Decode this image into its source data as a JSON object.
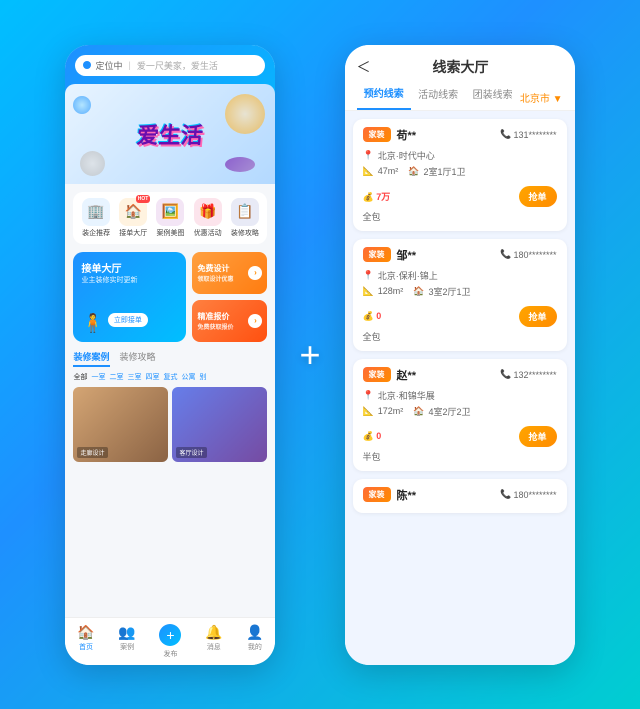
{
  "page": {
    "bg_gradient_start": "#00bfff",
    "bg_gradient_end": "#1e90ff"
  },
  "phone_left": {
    "status_text": "定位中",
    "search_placeholder": "爱一尺美家，爱生活",
    "banner_text": "爱生活",
    "icon_grid": [
      {
        "icon": "🏢",
        "label": "装企推荐",
        "color": "#e8f4ff",
        "hot": false
      },
      {
        "icon": "🏠",
        "label": "接单大厅",
        "color": "#fff3e0",
        "hot": true
      },
      {
        "icon": "🖼️",
        "label": "案例美图",
        "color": "#f3e5f5",
        "hot": false
      },
      {
        "icon": "🎁",
        "label": "优惠活动",
        "color": "#fce4ec",
        "hot": false
      },
      {
        "icon": "📋",
        "label": "装修攻略",
        "color": "#e8eaf6",
        "hot": false
      }
    ],
    "promo_left": {
      "title": "接单大厅",
      "sub": "业主装修实时更新",
      "btn_label": "立即接单"
    },
    "promo_right": [
      {
        "label": "免费设计",
        "color": "#ff8c00"
      },
      {
        "label": "精准报价",
        "color": "#ff6b35"
      }
    ],
    "case_tabs": [
      "装修案例",
      "装修攻略"
    ],
    "filter_tags": [
      "全部",
      "一室",
      "二室",
      "三室",
      "四室",
      "复式",
      "公寓",
      "别"
    ],
    "nav_items": [
      {
        "icon": "🏠",
        "label": "首页",
        "active": true
      },
      {
        "icon": "👥",
        "label": "案例",
        "active": false
      },
      {
        "icon": "+",
        "label": "发布",
        "is_plus": true
      },
      {
        "icon": "🔔",
        "label": "消息",
        "active": false
      },
      {
        "icon": "👤",
        "label": "我的",
        "active": false
      }
    ]
  },
  "plus_sign": "+",
  "phone_right": {
    "back_label": "＜",
    "title": "线索大厅",
    "tabs": [
      {
        "label": "预约线索",
        "active": true
      },
      {
        "label": "活动线索",
        "active": false
      },
      {
        "label": "团装线索",
        "active": false
      }
    ],
    "city": "北京市 ▼",
    "leads": [
      {
        "type": "家装",
        "name": "苟**",
        "phone": "131********",
        "location": "北京·时代中心",
        "area": "47m²",
        "rooms": "2室1厅1卫",
        "price": "7万",
        "style": "全包",
        "btn": "抢单"
      },
      {
        "type": "家装",
        "name": "邹**",
        "phone": "180********",
        "location": "北京·保利·锦上",
        "area": "128m²",
        "rooms": "3室2厅1卫",
        "price": "0",
        "style": "全包",
        "btn": "抢单"
      },
      {
        "type": "家装",
        "name": "赵**",
        "phone": "132********",
        "location": "北京·和锦华展",
        "area": "172m²",
        "rooms": "4室2厅2卫",
        "price": "0",
        "style": "半包",
        "btn": "抢单"
      },
      {
        "type": "家装",
        "name": "陈**",
        "phone": "180********",
        "location": "",
        "area": "",
        "rooms": "",
        "price": "",
        "style": "",
        "btn": "抢单"
      }
    ]
  }
}
